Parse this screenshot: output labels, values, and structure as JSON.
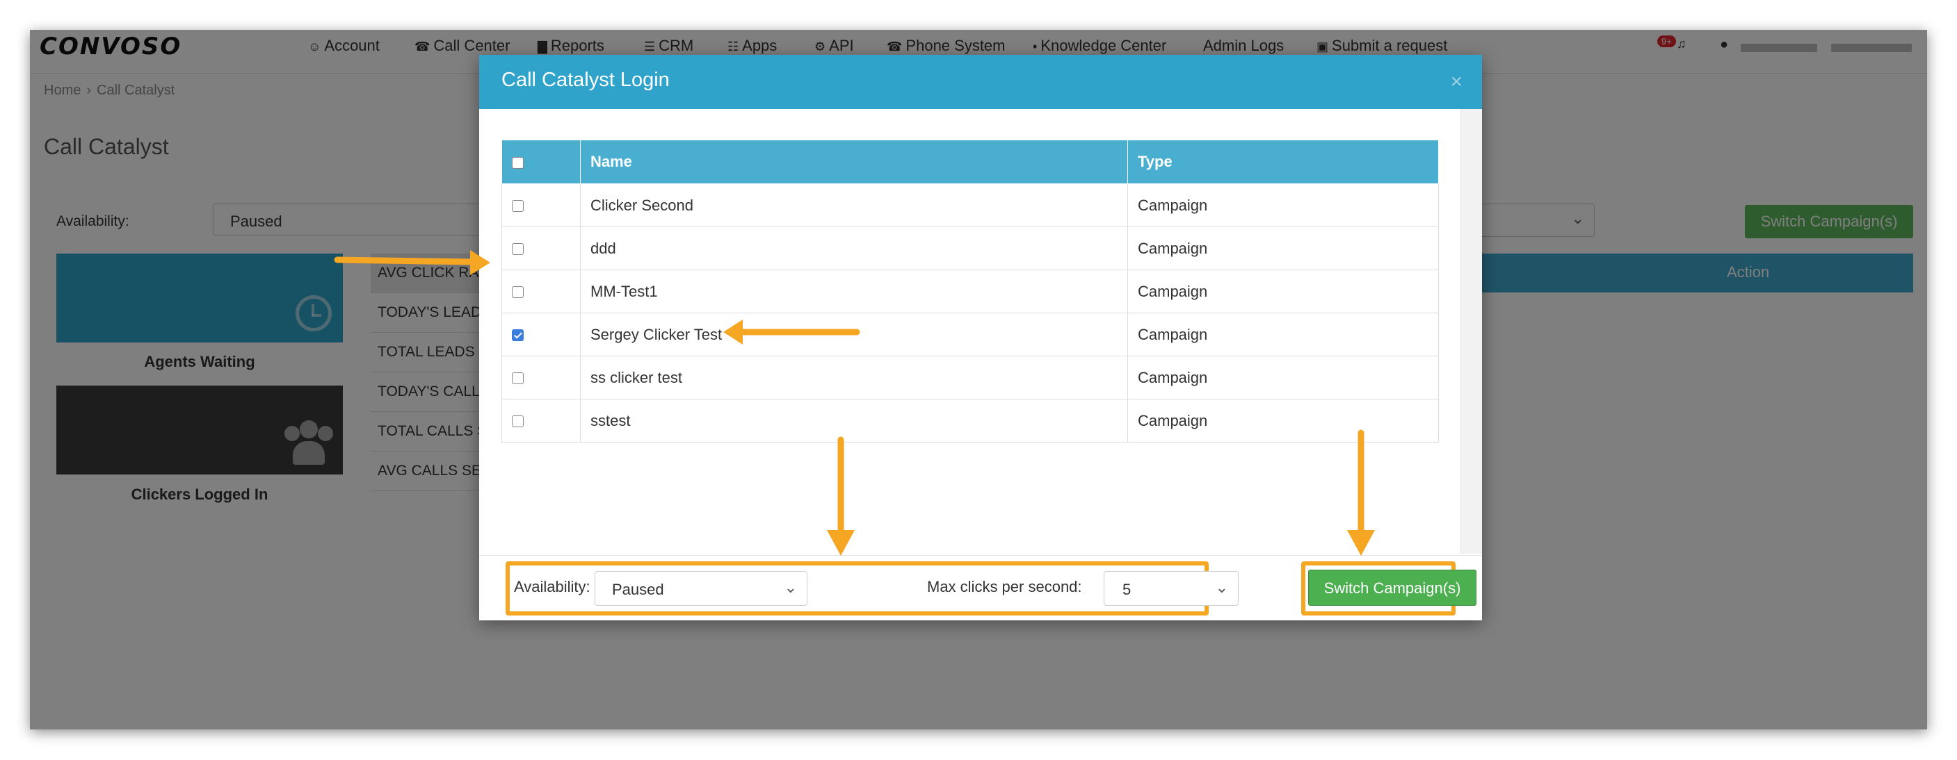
{
  "app": {
    "logo": "CONVOSO"
  },
  "nav": [
    {
      "icon": "user-icon",
      "glyph": "☺",
      "label": "Account"
    },
    {
      "icon": "phone-icon",
      "glyph": "☎",
      "label": "Call Center"
    },
    {
      "icon": "bar-chart-icon",
      "glyph": "▇",
      "label": "Reports"
    },
    {
      "icon": "list-icon",
      "glyph": "☰",
      "label": "CRM"
    },
    {
      "icon": "grid-icon",
      "glyph": "☷",
      "label": "Apps"
    },
    {
      "icon": "gear-icon",
      "glyph": "⚙",
      "label": "API"
    },
    {
      "icon": "phone-icon",
      "glyph": "☎",
      "label": "Phone System"
    },
    {
      "icon": "lightbulb-icon",
      "glyph": "•",
      "label": "Knowledge Center"
    },
    {
      "icon": "none",
      "glyph": "",
      "label": "Admin Logs"
    },
    {
      "icon": "ticket-icon",
      "glyph": "▣",
      "label": "Submit a request"
    }
  ],
  "notifications": {
    "badge": "9+"
  },
  "breadcrumb": {
    "home": "Home",
    "current": "Call Catalyst"
  },
  "page": {
    "title": "Call Catalyst",
    "availability_label": "Availability:",
    "availability_value": "Paused",
    "switch_button": "Switch Campaign(s)",
    "action_header": "Action",
    "tiles": {
      "agents": "Agents Waiting",
      "clickers": "Clickers Logged In"
    },
    "stats": [
      "AVG CLICK RATE",
      "TODAY'S LEADS",
      "TOTAL LEADS S",
      "TODAY'S CALLS",
      "TOTAL CALLS S",
      "AVG CALLS SEN"
    ]
  },
  "modal": {
    "title": "Call Catalyst Login",
    "close": "×",
    "columns": {
      "name": "Name",
      "type": "Type"
    },
    "rows": [
      {
        "name": "Clicker Second",
        "type": "Campaign",
        "checked": false
      },
      {
        "name": "ddd",
        "type": "Campaign",
        "checked": false
      },
      {
        "name": "MM-Test1",
        "type": "Campaign",
        "checked": false
      },
      {
        "name": "Sergey Clicker Test",
        "type": "Campaign",
        "checked": true
      },
      {
        "name": "ss clicker test",
        "type": "Campaign",
        "checked": false
      },
      {
        "name": "sstest",
        "type": "Campaign",
        "checked": false
      }
    ],
    "footer": {
      "availability_label": "Availability:",
      "availability_value": "Paused",
      "max_clicks_label": "Max clicks per second:",
      "max_clicks_value": "5",
      "switch_button": "Switch Campaign(s)"
    }
  },
  "colors": {
    "accent": "#2fa3c9",
    "header_row": "#4aaed1",
    "success": "#4caf50",
    "annotation": "#f5a623",
    "overlay": "rgba(0,0,0,0.5)"
  }
}
